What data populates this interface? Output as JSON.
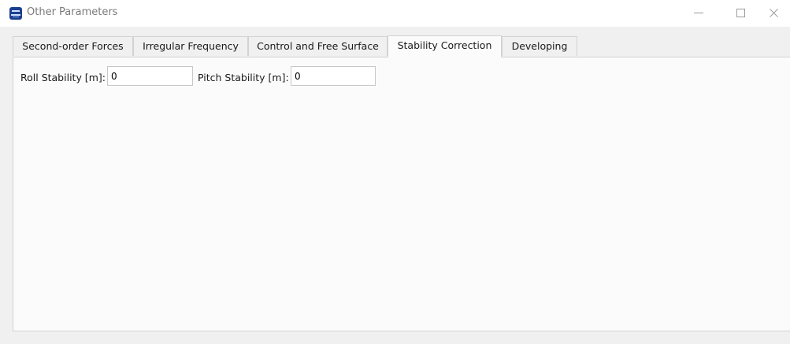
{
  "window": {
    "title": "Other Parameters",
    "icon": "app-logo-icon",
    "controls": [
      "minimize-icon",
      "maximize-icon",
      "close-icon"
    ]
  },
  "tabs": [
    {
      "label": "Second-order Forces",
      "active": false
    },
    {
      "label": "Irregular Frequency",
      "active": false
    },
    {
      "label": "Control and Free Surface",
      "active": false
    },
    {
      "label": "Stability Correction",
      "active": true
    },
    {
      "label": "Developing",
      "active": false
    }
  ],
  "stability_correction": {
    "roll": {
      "label": "Roll Stability [m]:",
      "value": "0"
    },
    "pitch": {
      "label": "Pitch Stability [m]:",
      "value": "0"
    }
  }
}
